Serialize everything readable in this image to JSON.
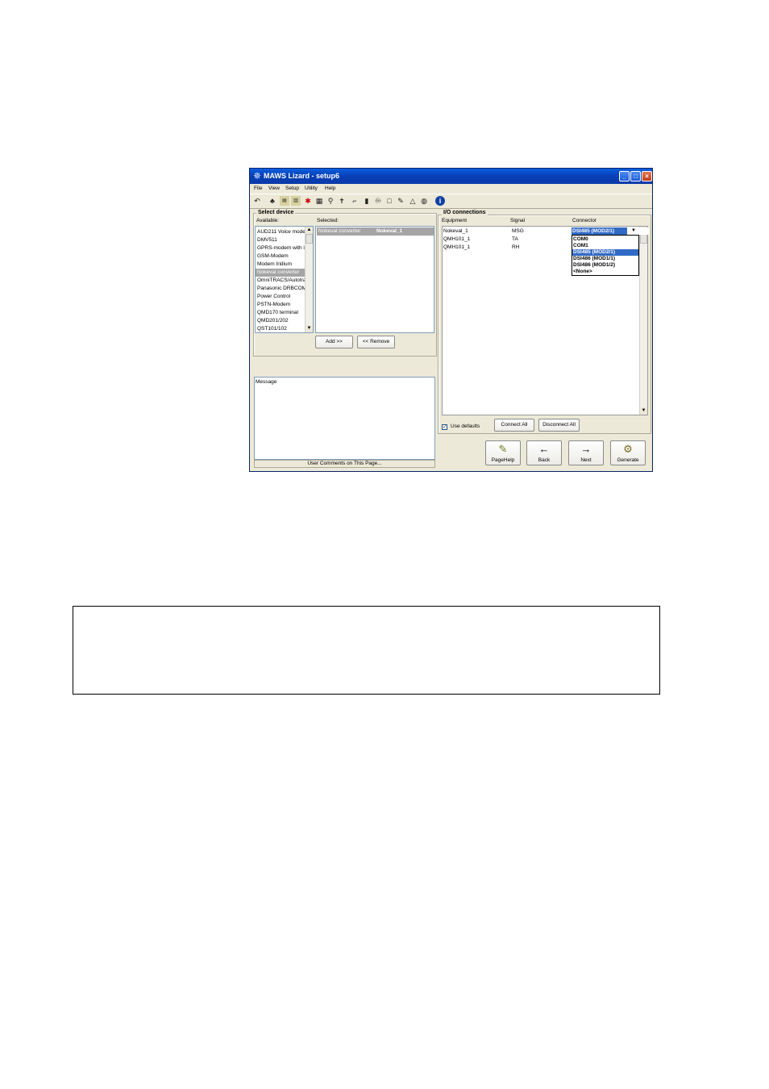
{
  "window": {
    "title": "MAWS Lizard - setup6",
    "controls": {
      "minimize": "_",
      "maximize": "□",
      "close": "×"
    }
  },
  "menu": [
    "File",
    "View",
    "Setup",
    "Utility",
    "Help"
  ],
  "toolbar_icons": [
    "undo-icon",
    "station-icon",
    "dev-icon",
    "dev2-icon",
    "sensor-icon",
    "logger-icon",
    "antenna-icon",
    "person-icon",
    "signal-icon",
    "bars-icon",
    "bike-icon",
    "page-icon",
    "pencil-icon",
    "bell-icon",
    "globe-icon",
    "info-icon"
  ],
  "select_device": {
    "group_label": "Select device",
    "available_label": "Available:",
    "selected_label": "Selected:",
    "available": [
      "AUD211 Voice modem",
      "DMV511",
      "GPRS-modem with i",
      "GSM-Modem",
      "Modem Iridium",
      "Nokeval converter",
      "OmniTRACS/Autotra",
      "Panasonic DRBCOM",
      "Power Control",
      "PSTN-Modem",
      "QMD170 terminal",
      "QMD201/202",
      "QST101/102"
    ],
    "available_selected_index": 5,
    "selected": [
      {
        "type": "Nokeval converter",
        "name": "Nokeval_1"
      }
    ],
    "add_button": "Add >>",
    "remove_button": "<< Remove"
  },
  "message": {
    "label": "Message",
    "footer": "User Comments on This Page..."
  },
  "io_connections": {
    "group_label": "I/O connections",
    "columns": [
      "Equipment",
      "Signal",
      "Connector"
    ],
    "rows": [
      {
        "equipment": "Nokeval_1",
        "signal": "MSG"
      },
      {
        "equipment": "QMH101_1",
        "signal": "TA"
      },
      {
        "equipment": "QMH101_1",
        "signal": "RH"
      }
    ],
    "connector_value": "DSI485 (MOD2/1)",
    "dropdown_options": [
      "COM0",
      "COM1",
      "DSI485 (MOD2/1)",
      "DSI486 (MOD1/1)",
      "DSI486 (MOD1/2)",
      "<None>"
    ],
    "dropdown_selected_index": 2,
    "use_defaults_label": "Use defaults",
    "use_defaults_checked": "✓",
    "connect_all": "Connect All",
    "disconnect_all": "Disconnect All"
  },
  "nav_buttons": [
    {
      "label": "PageHelp",
      "icon": "pagehelp-icon",
      "glyph": "✎"
    },
    {
      "label": "Back",
      "icon": "back-arrow-icon",
      "glyph": "←"
    },
    {
      "label": "Next",
      "icon": "next-arrow-icon",
      "glyph": "→"
    },
    {
      "label": "Generate",
      "icon": "gears-icon",
      "glyph": "⚙"
    }
  ],
  "colors": {
    "titlebar": "#0a5fe0",
    "selection": "#316ac5",
    "list_selection": "#a5a5a5",
    "window_bg": "#ece9d8"
  }
}
